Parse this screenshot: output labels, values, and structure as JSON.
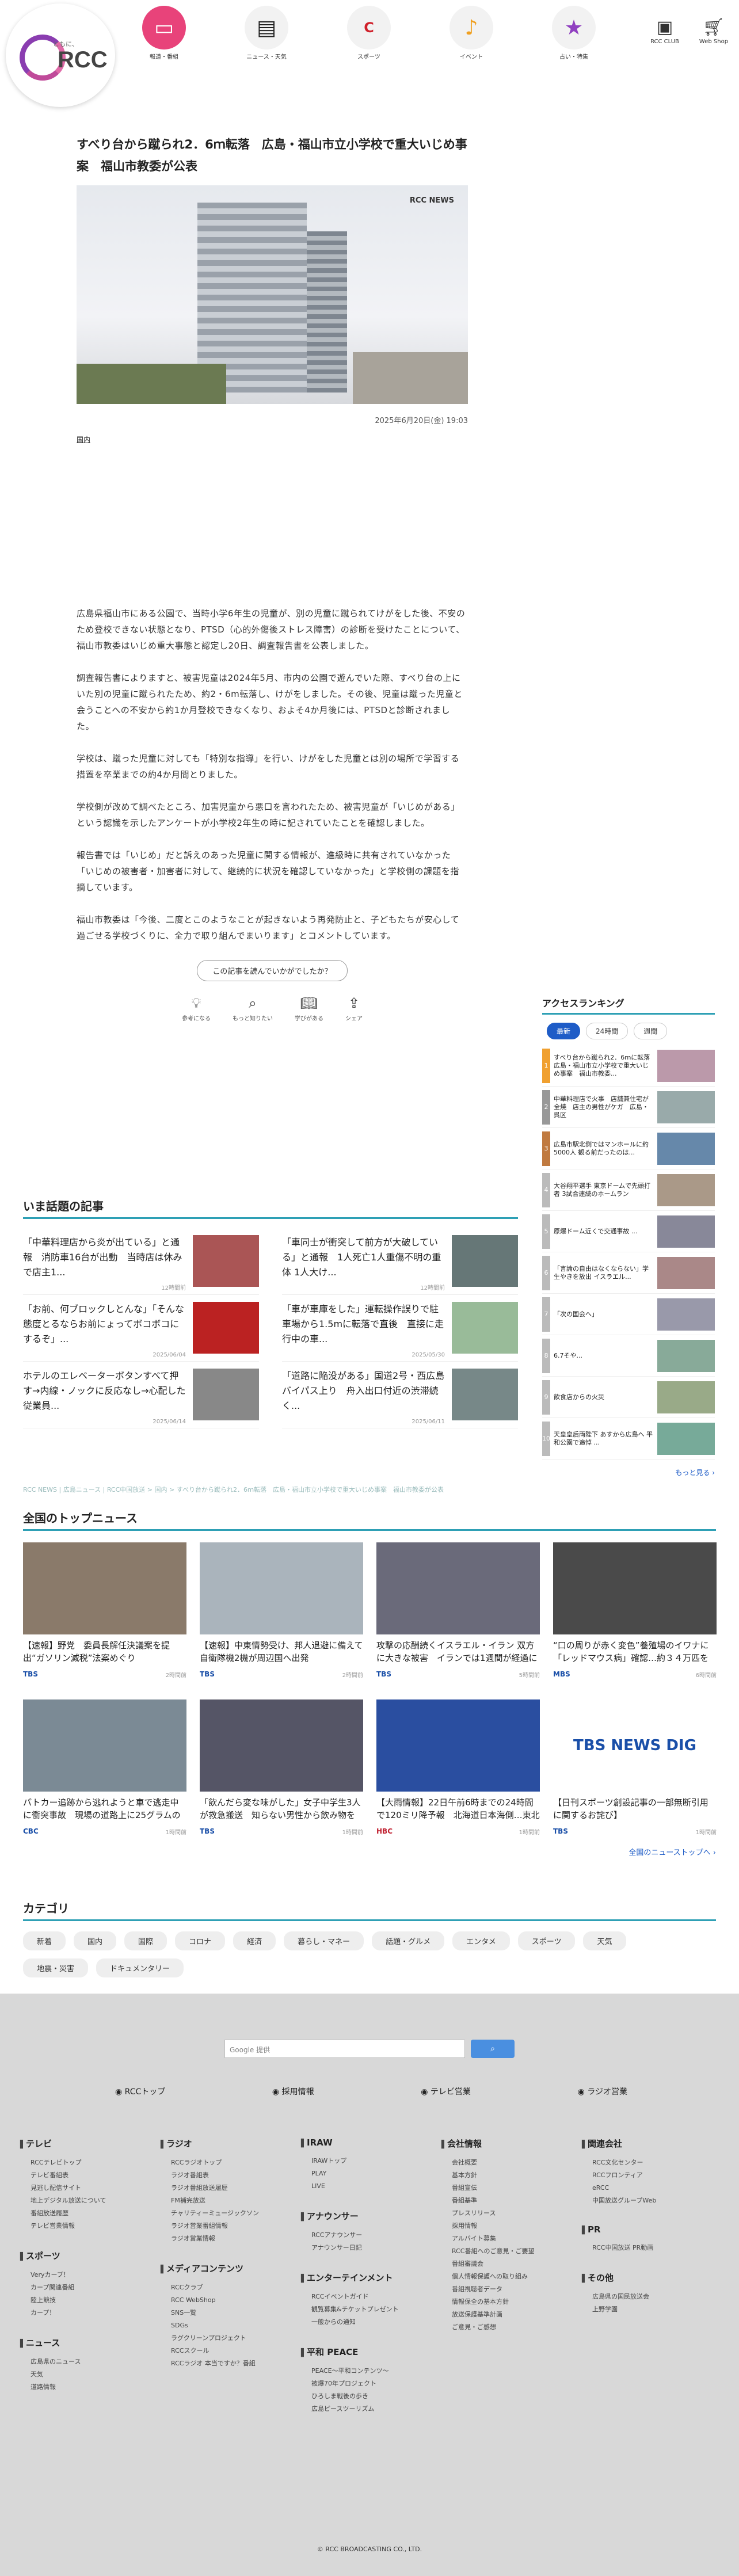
{
  "header": {
    "logo_sub": "ともに、",
    "logo_name": "RCC",
    "nav": [
      {
        "label": "報道・番組",
        "icon": "tv-icon",
        "active": true
      },
      {
        "label": "ニュース・天気",
        "icon": "newspaper-icon"
      },
      {
        "label": "スポーツ",
        "icon": "carp-icon"
      },
      {
        "label": "イベント",
        "icon": "music-note-icon"
      },
      {
        "label": "占い・特集",
        "icon": "star-icon"
      }
    ],
    "club": "RCC CLUB",
    "shop": "Web Shop"
  },
  "article": {
    "title": "すべり台から蹴られ2．6ｍ転落　広島・福山市立小学校で重大いじめ事案　福山市教委が公表",
    "photo_credit": "RCC NEWS",
    "date": "2025年6月20日(金) 19:03",
    "category": "国内",
    "paragraphs": [
      "広島県福山市にある公園で、当時小学6年生の児童が、別の児童に蹴られてけがをした後、不安のため登校できない状態となり、PTSD（心的外傷後ストレス障害）の診断を受けたことについて、福山市教委はいじめ重大事態と認定し20日、調査報告書を公表しました。",
      "調査報告書によりますと、被害児童は2024年5月、市内の公園で遊んでいた際、すべり台の上にいた別の児童に蹴られたため、約2・6m転落し、けがをしました。その後、児童は蹴った児童と会うことへの不安から約1か月登校できなくなり、およそ4か月後には、PTSDと診断されました。",
      "学校は、蹴った児童に対しても「特別な指導」を行い、けがをした児童とは別の場所で学習する措置を卒業までの約4か月間とりました。",
      "学校側が改めて調べたところ、加害児童から悪口を言われたため、被害児童が「いじめがある」という認識を示したアンケートが小学校2年生の時に記されていたことを確認しました。",
      "報告書では「いじめ」だと訴えのあった児童に関する情報が、進級時に共有されていなかった「いじめの被害者・加害者に対して、継続的に状況を確認していなかった」と学校側の課題を指摘しています。",
      "福山市教委は「今後、二度とこのようなことが起きないよう再発防止と、子どもたちが安心して過ごせる学校づくりに、全力で取り組んでまいります」とコメントしています。"
    ],
    "feedback": {
      "question": "この記事を読んでいかがでしたか？",
      "buttons": [
        {
          "label": "参考になる",
          "icon": "lightbulb-icon"
        },
        {
          "label": "もっと知りたい",
          "icon": "magnifier-icon"
        },
        {
          "label": "学びがある",
          "icon": "book-icon"
        },
        {
          "label": "シェア",
          "icon": "share-icon"
        }
      ]
    }
  },
  "ranking": {
    "title": "アクセスランキング",
    "tabs": [
      "最新",
      "24時間",
      "週間"
    ],
    "items": [
      {
        "rank": "1",
        "text": "すべり台から蹴られ2．6ｍに転落　広島・福山市立小学校で重大いじめ事案　福山市教委..."
      },
      {
        "rank": "2",
        "text": "中華料理店で火事　店舗兼住宅が全焼　店主の男性がケガ　広島・呉区"
      },
      {
        "rank": "3",
        "text": "広島市駅北側ではマンホールに約5000人 観る前だったのは..."
      },
      {
        "rank": "4",
        "text": "大谷翔平選手 東京ドームで先頭打者 3試合連続のホームラン"
      },
      {
        "rank": "5",
        "text": "原爆ドーム近くで交通事故 ..."
      },
      {
        "rank": "6",
        "text": "「言論の自由はなくならない」学生やきを放出 イスラエル..."
      },
      {
        "rank": "7",
        "text": "「次の国会へ」"
      },
      {
        "rank": "8",
        "text": "6.7そや..."
      },
      {
        "rank": "9",
        "text": "飲食店からの火災"
      },
      {
        "rank": "10",
        "text": "天皇皇后両陛下 あすから広島へ 平和公園で追悼 ..."
      }
    ],
    "more": "もっと見る ›"
  },
  "trending": {
    "title": "いま話題の記事",
    "items": [
      {
        "text": "「中華料理店から炎が出ている」と通報　消防車16台が出動　当時店は休みで店主1...",
        "date": "12時間前"
      },
      {
        "text": "「車同士が衝突して前方が大破している」と通報　1人死亡1人重傷不明の重体 1人大け...",
        "date": "12時間前"
      },
      {
        "text": "「お前、何ブロックしとんな」「そんな態度とるならお前にょってボコボコにするぞ」...",
        "date": "2025/06/04"
      },
      {
        "text": "「車が車庫をした」運転操作誤りで駐車場から1.5mに転落で直後　直接に走行中の車...",
        "date": "2025/05/30"
      },
      {
        "text": "ホテルのエレベーターボタンすべて押す→内線・ノックに反応なし→心配した従業員...",
        "date": "2025/06/14"
      },
      {
        "text": "「道路に陥没がある」国道2号・西広島バイパス上り　舟入出口付近の渋滞続く...",
        "date": "2025/06/11"
      }
    ]
  },
  "breadcrumb": "RCC NEWS | 広島ニュース | RCC中国放送 > 国内 > すべり台から蹴られ2．6ｍ転落　広島・福山市立小学校で重大いじめ事案　福山市教委が公表",
  "topnews": {
    "title": "全国のトップニュース",
    "items": [
      {
        "text": "【速報】野党　委員長解任決議案を提出“ガソリン減税”法案めぐり",
        "src": "TBS",
        "ago": "2時間前"
      },
      {
        "text": "【速報】中東情勢受け、邦人退避に備えて自衛隊機2機が周辺国へ出発",
        "src": "TBS",
        "ago": "2時間前"
      },
      {
        "text": "攻撃の応酬続くイスラエル・イラン 双方に大きな被害　イランでは1週間が経過に　イスラエル北部ハイファでは...",
        "src": "TBS",
        "ago": "5時間前"
      },
      {
        "text": "“口の周りが赤く変色”養殖場のイワナに「レッドマウス病」確認…約３４万匹を殺処分　滋賀・米原市",
        "src": "MBS",
        "ago": "6時間前"
      },
      {
        "text": "パトカー追跡から逃れようと車で逃走中に衝突事故　現場の道路上に25グラムの乾燥大麻が...所持した疑いで...",
        "src": "CBC",
        "ago": "1時間前"
      },
      {
        "text": "「飲んだら変な味がした」女子中学生3人が救急搬送　知らない男性から飲み物を渡され体調が悪くなったか　東...",
        "src": "TBS",
        "ago": "1時間前"
      },
      {
        "text": "【大雨情報】22日午前6時までの24時間で120ミリ降予報　北海道日本海側…東北地方も23日朝までに100ミリ...",
        "src": "HBC",
        "ago": "1時間前"
      },
      {
        "text": "【日刊スポーツ創設記事の一部無断引用に関するお詫び】",
        "src": "TBS",
        "ago": "1時間前"
      }
    ],
    "more": "全国のニューストップへ ›",
    "dig": "TBS NEWS DIG"
  },
  "categories": {
    "title": "カテゴリ",
    "items": [
      "新着",
      "国内",
      "国際",
      "コロナ",
      "経済",
      "暮らし・マネー",
      "話題・グルメ",
      "エンタメ",
      "スポーツ",
      "天気",
      "地震・災害",
      "ドキュメンタリー"
    ]
  },
  "footer": {
    "search_label": "Google 提供",
    "search_btn": "検索",
    "nav": [
      "RCCトップ",
      "採用情報",
      "テレビ営業",
      "ラジオ営業"
    ],
    "cols": [
      [
        {
          "h": "テレビ",
          "items": [
            "RCCテレビトップ",
            "テレビ番組表",
            "見逃し配信サイト",
            "地上デジタル放送について",
            "番組放送履歴",
            "テレビ営業情報"
          ]
        },
        {
          "h": "スポーツ",
          "items": [
            "Veryカープ！",
            "カープ関連番組",
            "陸上競技",
            "カープ！"
          ]
        },
        {
          "h": "ニュース",
          "items": [
            "広島県のニュース",
            "天気",
            "道路情報"
          ]
        }
      ],
      [
        {
          "h": "ラジオ",
          "items": [
            "RCCラジオトップ",
            "ラジオ番組表",
            "ラジオ番組放送履歴",
            "FM補完放送",
            "チャリティーミュージックソン",
            "ラジオ営業番組情報",
            "ラジオ営業情報"
          ]
        },
        {
          "h": "メディアコンテンツ",
          "items": [
            "RCCクラブ",
            "RCC WebShop",
            "SNS一覧",
            "SDGs",
            "ラグクリーンプロジェクト",
            "RCCスクール",
            "RCCラジオ 本当ですか？番組"
          ]
        }
      ],
      [
        {
          "h": "IRAW",
          "items": [
            "IRAWトップ",
            "PLAY",
            "LIVE"
          ]
        },
        {
          "h": "アナウンサー",
          "items": [
            "RCCアナウンサー",
            "アナウンサー日記"
          ]
        },
        {
          "h": "エンターテインメント",
          "items": [
            "RCCイベントガイド",
            "観覧募集&チケットプレゼント",
            "一般からの通知"
          ]
        },
        {
          "h": "平和 PEACE",
          "items": [
            "PEACE〜平和コンテンツ〜",
            "被爆70年プロジェクト",
            "ひろしま戦後の歩き",
            "広島ピースツーリズム"
          ]
        }
      ],
      [
        {
          "h": "会社情報",
          "items": [
            "会社概要",
            "基本方針",
            "番組宣伝",
            "番組基準",
            "プレスリリース",
            "採用情報",
            "アルバイト募集",
            "RCC番組へのご意見・ご要望",
            "番組審議会",
            "個人情報保護への取り組み",
            "番組視聴者データ",
            "情報保全の基本方針",
            "放送保護基準計画",
            "ご意見・ご感想"
          ]
        }
      ],
      [
        {
          "h": "関連会社",
          "items": [
            "RCC文化センター",
            "RCCフロンティア",
            "eRCC",
            "中国放送グループWeb"
          ]
        },
        {
          "h": "PR",
          "items": [
            "RCC中国放送 PR動画"
          ]
        },
        {
          "h": "その他",
          "items": [
            "広島県の国民放送会",
            "上野学園"
          ]
        }
      ]
    ],
    "copyright": "© RCC BROADCASTING CO., LTD."
  }
}
